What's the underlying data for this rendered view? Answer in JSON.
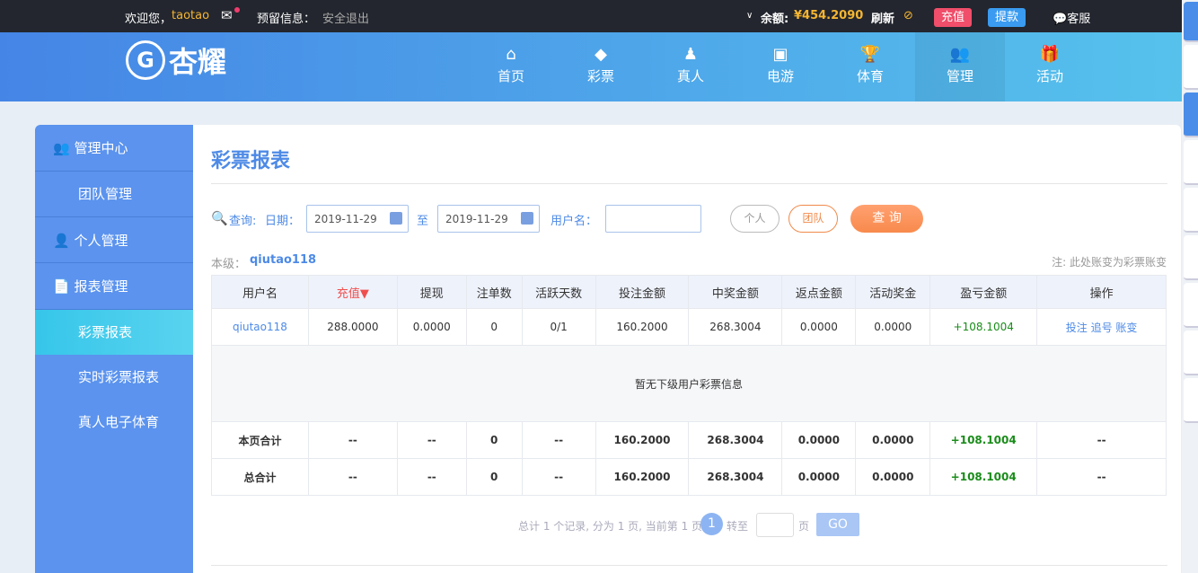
{
  "topbar": {
    "welcome": "欢迎您，",
    "username": "taotao",
    "notice": "预留信息：",
    "logout": "安全退出",
    "balance_label": "余额:",
    "balance": "¥454.2090",
    "refresh": "刷新",
    "deposit": "充值",
    "withdraw": "提款",
    "service": "客服"
  },
  "logo": {
    "text": "杏耀"
  },
  "nav": [
    {
      "label": "首页",
      "icon": "home-icon"
    },
    {
      "label": "彩票",
      "icon": "lottery-icon"
    },
    {
      "label": "真人",
      "icon": "live-icon"
    },
    {
      "label": "电游",
      "icon": "slot-icon"
    },
    {
      "label": "体育",
      "icon": "trophy-icon"
    },
    {
      "label": "管理",
      "icon": "users-icon"
    },
    {
      "label": "活动",
      "icon": "gift-icon"
    }
  ],
  "sidebar": {
    "groups": [
      {
        "label": "管理中心",
        "items": [
          "团队管理"
        ]
      },
      {
        "label": "个人管理",
        "items": []
      },
      {
        "label": "报表管理",
        "items": [
          "彩票报表",
          "实时彩票报表",
          "真人电子体育"
        ]
      }
    ]
  },
  "page": {
    "title": "彩票报表"
  },
  "filter": {
    "query": "查询:",
    "date_label": "日期：",
    "date_from": "2019-11-29",
    "to": "至",
    "date_to": "2019-11-29",
    "user_label": "用户名：",
    "user_value": "",
    "personal": "个人",
    "team": "团队",
    "search": "查 询"
  },
  "level": {
    "label": "本级：",
    "user": "qiutao118",
    "note": "注: 此处账变为彩票账变"
  },
  "table": {
    "headers": [
      "用户名",
      "充值▼",
      "提现",
      "注单数",
      "活跃天数",
      "投注金额",
      "中奖金额",
      "返点金额",
      "活动奖金",
      "盈亏金额",
      "操作"
    ],
    "row": [
      "qiutao118",
      "288.0000",
      "0.0000",
      "0",
      "0/1",
      "160.2000",
      "268.3004",
      "0.0000",
      "0.0000",
      "+108.1004"
    ],
    "actions": [
      "投注",
      "追号",
      "账变"
    ],
    "empty": "暂无下级用户彩票信息",
    "page_total": [
      "本页合计",
      "--",
      "--",
      "0",
      "--",
      "160.2000",
      "268.3004",
      "0.0000",
      "0.0000",
      "+108.1004",
      "--"
    ],
    "grand_total": [
      "总合计",
      "--",
      "--",
      "0",
      "--",
      "160.2000",
      "268.3004",
      "0.0000",
      "0.0000",
      "+108.1004",
      "--"
    ]
  },
  "pager": {
    "summary": "总计 1 个记录, 分为 1 页, 当前第 1 页",
    "current": "1",
    "goto": "转至",
    "page_unit": "页",
    "go": "GO"
  }
}
